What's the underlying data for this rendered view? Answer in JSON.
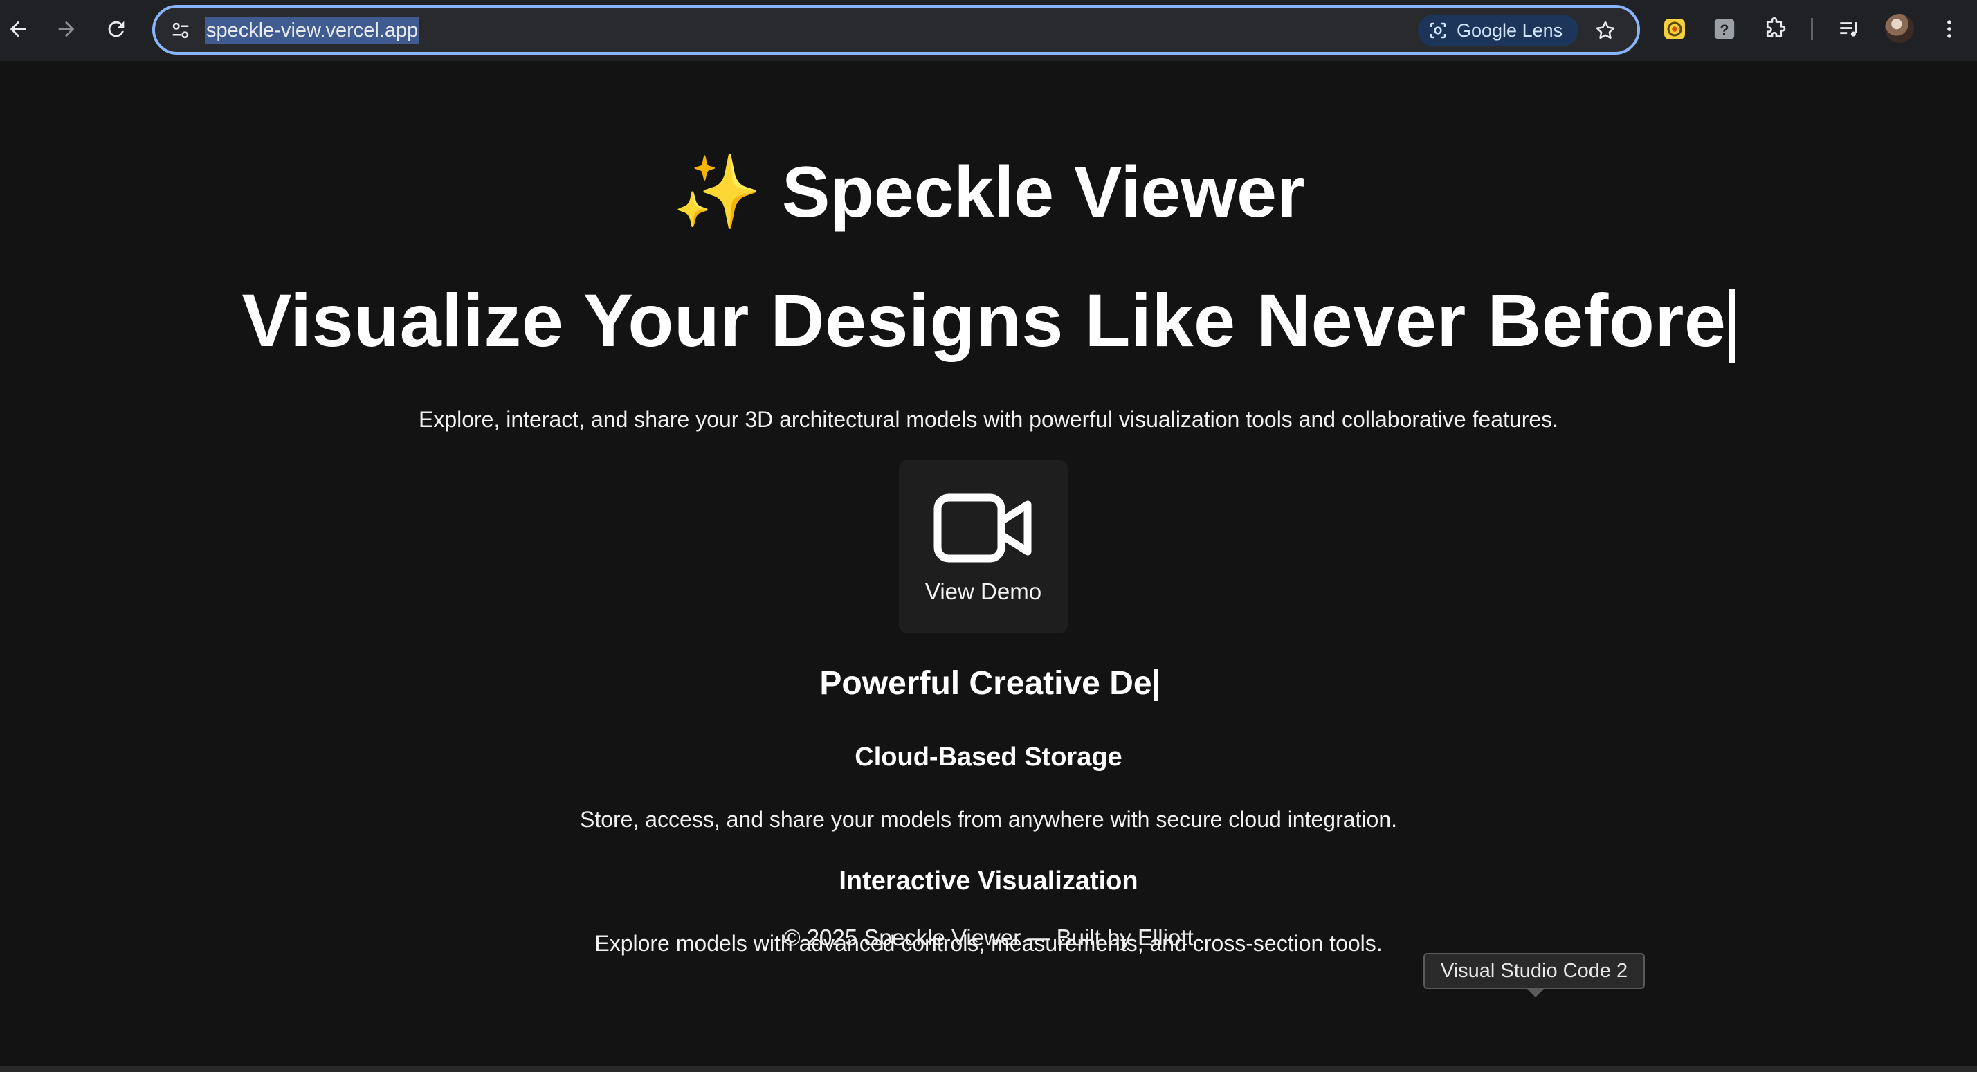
{
  "browser": {
    "url": "speckle-view.vercel.app",
    "lens_label": "Google Lens",
    "icons": {
      "back": "arrow-left-icon",
      "forward": "arrow-right-icon",
      "reload": "reload-icon",
      "site_info": "tune-icon",
      "lens": "lens-icon",
      "bookmark": "star-icon",
      "extension_1": "yellow-extension-icon",
      "extension_2": "help-extension-icon",
      "extensions": "puzzle-icon",
      "media": "media-queue-icon",
      "profile": "avatar",
      "menu": "kebab-menu-icon"
    }
  },
  "hero": {
    "sparkle": "✨",
    "brand": "Speckle Viewer",
    "headline": "Visualize Your Designs Like Never Before",
    "subtext": "Explore, interact, and share your 3D architectural models with powerful visualization tools and collaborative features."
  },
  "demo": {
    "label": "View Demo",
    "icon": "video-camera-icon"
  },
  "features": {
    "section_title": "Powerful Creative De",
    "items": [
      {
        "title": "Cloud-Based Storage",
        "description": "Store, access, and share your models from anywhere with secure cloud integration."
      },
      {
        "title": "Interactive Visualization",
        "description": "Explore models with advanced controls, measurements, and cross-section tools."
      }
    ]
  },
  "footer": {
    "text": "© 2025 Speckle Viewer — Built by Elliott"
  },
  "tooltip": {
    "text": "Visual Studio Code 2"
  }
}
